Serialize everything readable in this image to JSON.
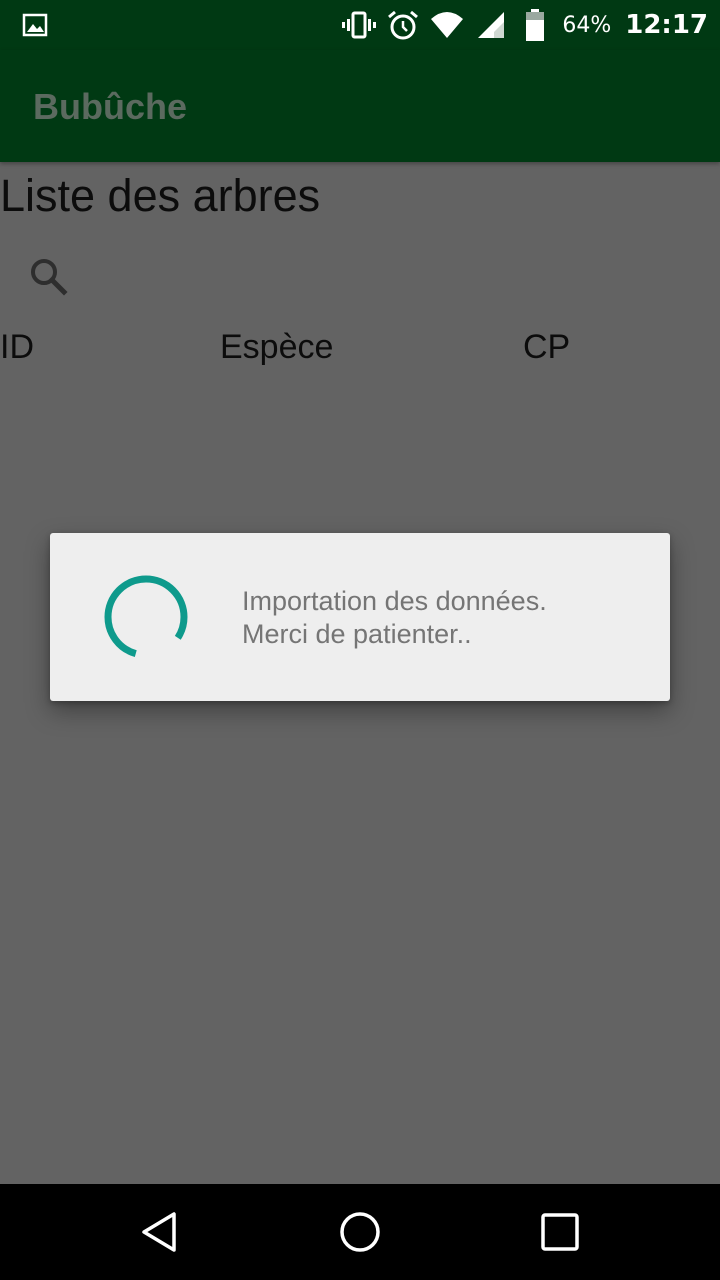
{
  "status_bar": {
    "notification_icon": "image-icon",
    "icons": [
      "vibrate-icon",
      "alarm-icon",
      "wifi-icon",
      "signal-icon",
      "battery-icon"
    ],
    "battery_percent": "64%",
    "time": "12:17"
  },
  "app_bar": {
    "title": "Bubûche"
  },
  "main": {
    "title": "Liste des arbres",
    "search_icon": "search-icon",
    "columns": [
      "ID",
      "Espèce",
      "CP"
    ]
  },
  "dialog": {
    "spinner_icon": "progress-spinner",
    "message_line1": "Importation des données.",
    "message_line2": "Merci de patienter.."
  },
  "nav_bar": {
    "back": "back-icon",
    "home": "home-icon",
    "recents": "recents-icon"
  },
  "colors": {
    "primary_dark": "#003913",
    "scrim_background": "#636363",
    "dialog_background": "#eeeeee",
    "spinner_accent": "#009688"
  }
}
